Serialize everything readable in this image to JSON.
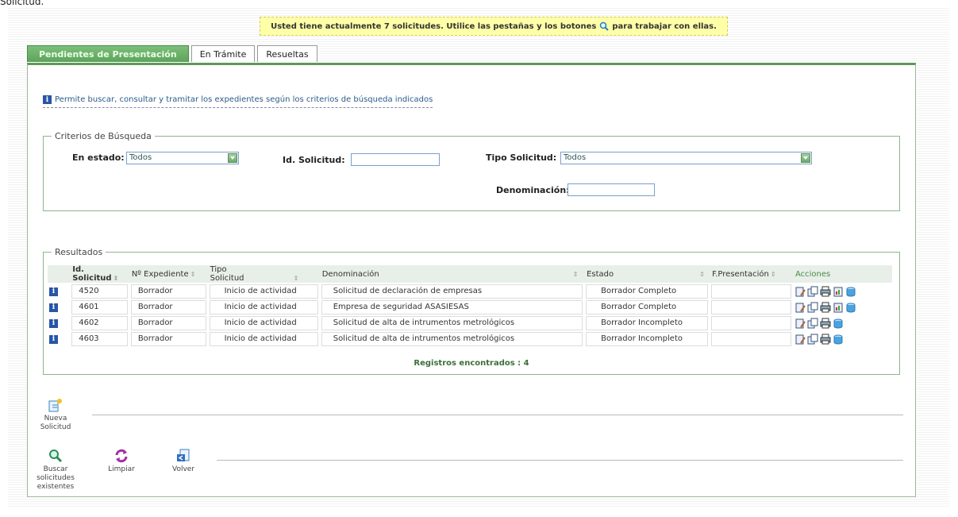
{
  "top_partial_text": "Solicitud.",
  "notice": {
    "before": "Usted tiene actualmente 7 solicitudes. Utilice las pestañas y los botones",
    "after": "para trabajar con ellas."
  },
  "tabs": [
    {
      "label": "Pendientes de Presentación"
    },
    {
      "label": "En Trámite"
    },
    {
      "label": "Resueltas"
    }
  ],
  "info": "Permite buscar, consultar y tramitar los expedientes según los criterios de búsqueda indicados",
  "search": {
    "legend": "Criterios de Búsqueda",
    "estado_label": "En estado:",
    "estado_value": "Todos",
    "id_label": "Id. Solicitud:",
    "id_value": "",
    "tipo_label": "Tipo Solicitud:",
    "tipo_value": "Todos",
    "denominacion_label": "Denominación:",
    "denominacion_value": ""
  },
  "results": {
    "legend": "Resultados",
    "columns": [
      "Id. Solicitud",
      "Nº Expediente",
      "Tipo Solicitud",
      "Denominación",
      "Estado",
      "F.Presentación",
      "Acciones"
    ],
    "rows": [
      {
        "id": "4520",
        "expediente": "Borrador",
        "tipo": "Inicio de actividad",
        "denominacion": "Solicitud de declaración de empresas",
        "estado": "Borrador Completo",
        "fecha": ""
      },
      {
        "id": "4601",
        "expediente": "Borrador",
        "tipo": "Inicio de actividad",
        "denominacion": "Empresa de seguridad ASASIESAS",
        "estado": "Borrador Completo",
        "fecha": ""
      },
      {
        "id": "4602",
        "expediente": "Borrador",
        "tipo": "Inicio de actividad",
        "denominacion": "Solicitud de alta de intrumentos metrológicos",
        "estado": "Borrador Incompleto",
        "fecha": ""
      },
      {
        "id": "4603",
        "expediente": "Borrador",
        "tipo": "Inicio de actividad",
        "denominacion": "Solicitud de alta de intrumentos metrológicos",
        "estado": "Borrador Incompleto",
        "fecha": ""
      }
    ],
    "found": "Registros encontrados : 4"
  },
  "buttons": {
    "nueva_1": "Nueva",
    "nueva_2": "Solicitud",
    "buscar_1": "Buscar",
    "buscar_2": "solicitudes",
    "buscar_3": "existentes",
    "limpiar": "Limpiar",
    "volver": "Volver"
  },
  "colors": {
    "tab_active": "#5ea35b",
    "notice_bg": "#ffffa8",
    "info_icon": "#2756a8",
    "found_text": "#3b6f38"
  }
}
